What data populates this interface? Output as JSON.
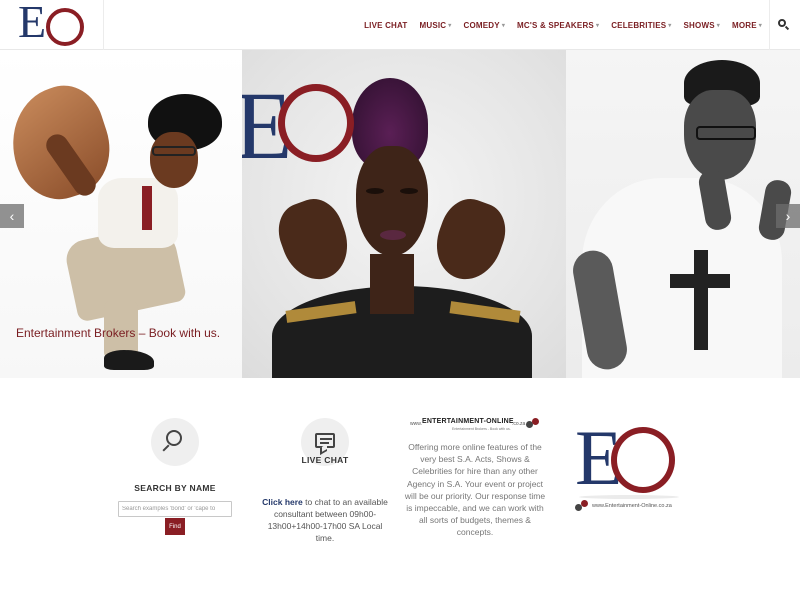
{
  "header": {
    "logo_alt": "EO",
    "nav": [
      {
        "label": "LIVE CHAT",
        "has_dropdown": false
      },
      {
        "label": "MUSIC",
        "has_dropdown": true
      },
      {
        "label": "COMEDY",
        "has_dropdown": true
      },
      {
        "label": "MC'S & SPEAKERS",
        "has_dropdown": true
      },
      {
        "label": "CELEBRITIES",
        "has_dropdown": true
      },
      {
        "label": "SHOWS",
        "has_dropdown": true
      },
      {
        "label": "MORE",
        "has_dropdown": true
      }
    ],
    "search_icon": "search-icon"
  },
  "slider": {
    "caption": "Entertainment Brokers – Book with us.",
    "prev_icon": "chevron-left-icon",
    "next_icon": "chevron-right-icon",
    "prev_glyph": "‹",
    "next_glyph": "›",
    "overlay_logo": "EO"
  },
  "features": {
    "search": {
      "icon": "magnifier-icon",
      "title": "SEARCH BY NAME",
      "placeholder": "Search examples 'bond' or 'cape to",
      "button_label": "Find"
    },
    "chat": {
      "icon": "chat-bubble-icon",
      "title": "LIVE CHAT",
      "link_text": "Click here",
      "body": " to chat to an available consultant between 09h00-13h00+14h00-17h00 SA Local time."
    },
    "offer": {
      "banner_prefix": "www.",
      "banner_name": "ENTERTAINMENT-ONLINE",
      "banner_suffix": ".co.za",
      "banner_tagline": "Entertainment Brokers - Book with us.",
      "text": "Offering more online features of the very best S.A. Acts, Shows & Celebrities for hire than any other Agency in S.A. Your event or project will be our priority. Our response time is impeccable, and we can work with all sorts of budgets, themes & concepts."
    },
    "brand": {
      "logo_e": "E",
      "url": "www.Entertainment-Online.co.za"
    }
  },
  "colors": {
    "brand_blue": "#24386a",
    "brand_red": "#8a1e24",
    "nav_text": "#7a1e22"
  }
}
